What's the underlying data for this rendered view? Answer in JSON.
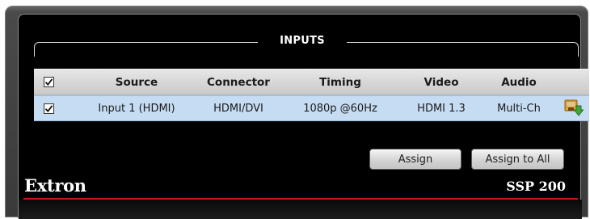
{
  "panel": {
    "group_title": "INPUTS",
    "brand": "Extron",
    "model": "SSP 200"
  },
  "table": {
    "header": {
      "select_all_checked": true,
      "columns": [
        "Source",
        "Connector",
        "Timing",
        "Video",
        "Audio"
      ]
    },
    "rows": [
      {
        "checked": true,
        "source": "Input 1 (HDMI)",
        "connector": "HDMI/DVI",
        "timing": "1080p @60Hz",
        "video": "HDMI 1.3",
        "audio": "Multi-Ch",
        "icon": "save-download-icon"
      }
    ]
  },
  "buttons": {
    "assign": "Assign",
    "assign_all": "Assign to All"
  },
  "colors": {
    "row_selected": "#c6dcf2",
    "accent_red": "#c0181c",
    "panel_bg": "#000000"
  }
}
